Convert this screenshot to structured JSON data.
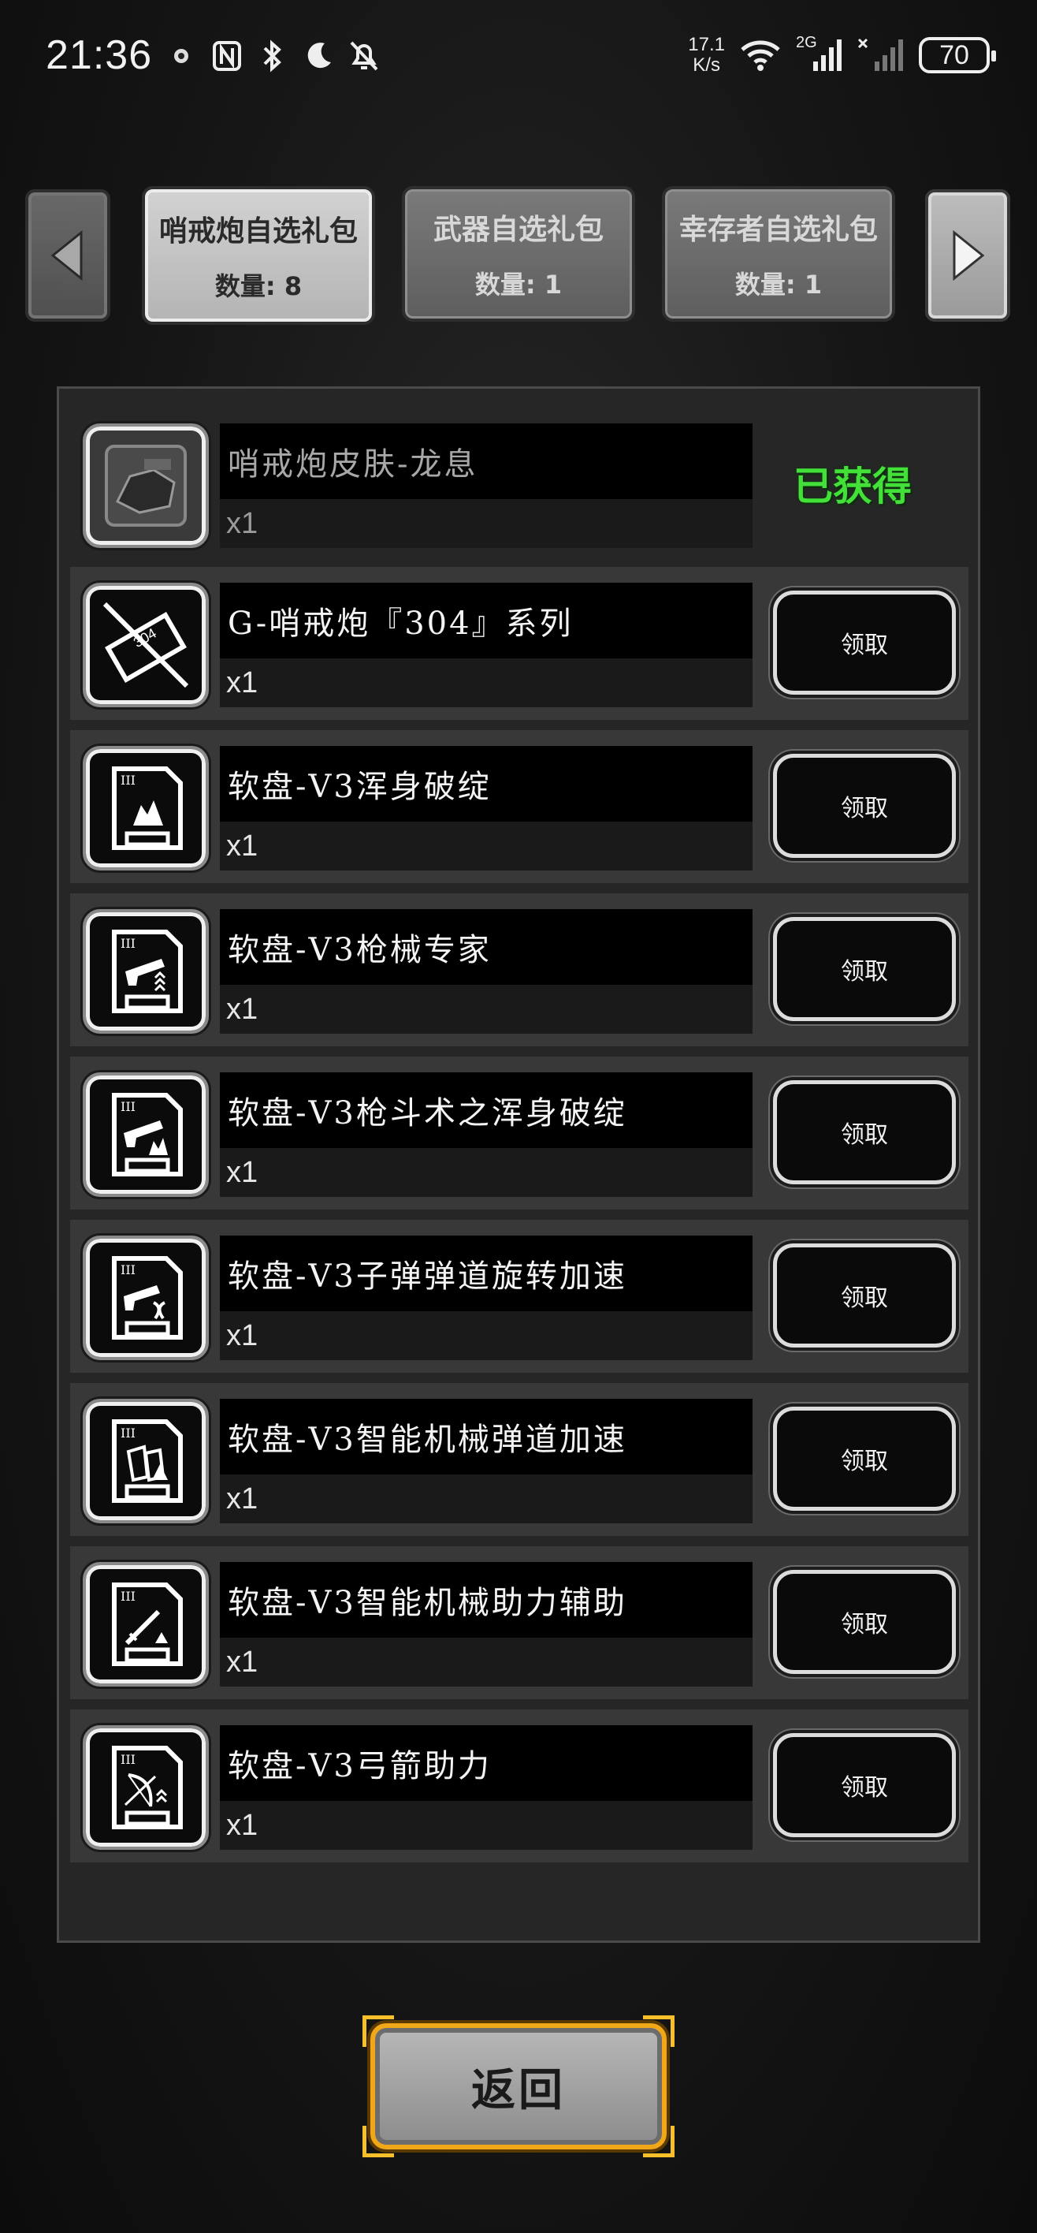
{
  "status_bar": {
    "time": "21:36",
    "net_speed_value": "17.1",
    "net_speed_unit": "K/s",
    "signal_label": "2G",
    "battery": "70",
    "icons": [
      "vpn-icon",
      "nfc-icon",
      "bluetooth-icon",
      "moon-icon",
      "bell-off-icon",
      "wifi-icon",
      "signal-icon",
      "no-signal-icon",
      "battery-icon"
    ]
  },
  "tabs": [
    {
      "name": "哨戒炮自选礼包",
      "count": "数量: 8",
      "active": true
    },
    {
      "name": "武器自选礼包",
      "count": "数量: 1",
      "active": false
    },
    {
      "name": "幸存者自选礼包",
      "count": "数量: 1",
      "active": false
    }
  ],
  "items": [
    {
      "name": "哨戒炮皮肤-龙息",
      "qty": "x1",
      "status": "已获得",
      "icon": "turret-skin-icon"
    },
    {
      "name": "G-哨戒炮『304』系列",
      "qty": "x1",
      "button": "领取",
      "icon": "turret-304-icon"
    },
    {
      "name": "软盘-V3浑身破绽",
      "qty": "x1",
      "button": "领取",
      "icon": "floppy-flaw-icon"
    },
    {
      "name": "软盘-V3枪械专家",
      "qty": "x1",
      "button": "领取",
      "icon": "floppy-gun-expert-icon"
    },
    {
      "name": "软盘-V3枪斗术之浑身破绽",
      "qty": "x1",
      "button": "领取",
      "icon": "floppy-gun-kata-icon"
    },
    {
      "name": "软盘-V3子弹弹道旋转加速",
      "qty": "x1",
      "button": "领取",
      "icon": "floppy-bullet-spin-icon"
    },
    {
      "name": "软盘-V3智能机械弹道加速",
      "qty": "x1",
      "button": "领取",
      "icon": "floppy-smart-ballistic-icon"
    },
    {
      "name": "软盘-V3智能机械助力辅助",
      "qty": "x1",
      "button": "领取",
      "icon": "floppy-smart-assist-icon"
    },
    {
      "name": "软盘-V3弓箭助力",
      "qty": "x1",
      "button": "领取",
      "icon": "floppy-bow-icon"
    }
  ],
  "back_button": "返回",
  "colors": {
    "obtained_green": "#44e03a",
    "back_border_gold": "#f0a818"
  }
}
